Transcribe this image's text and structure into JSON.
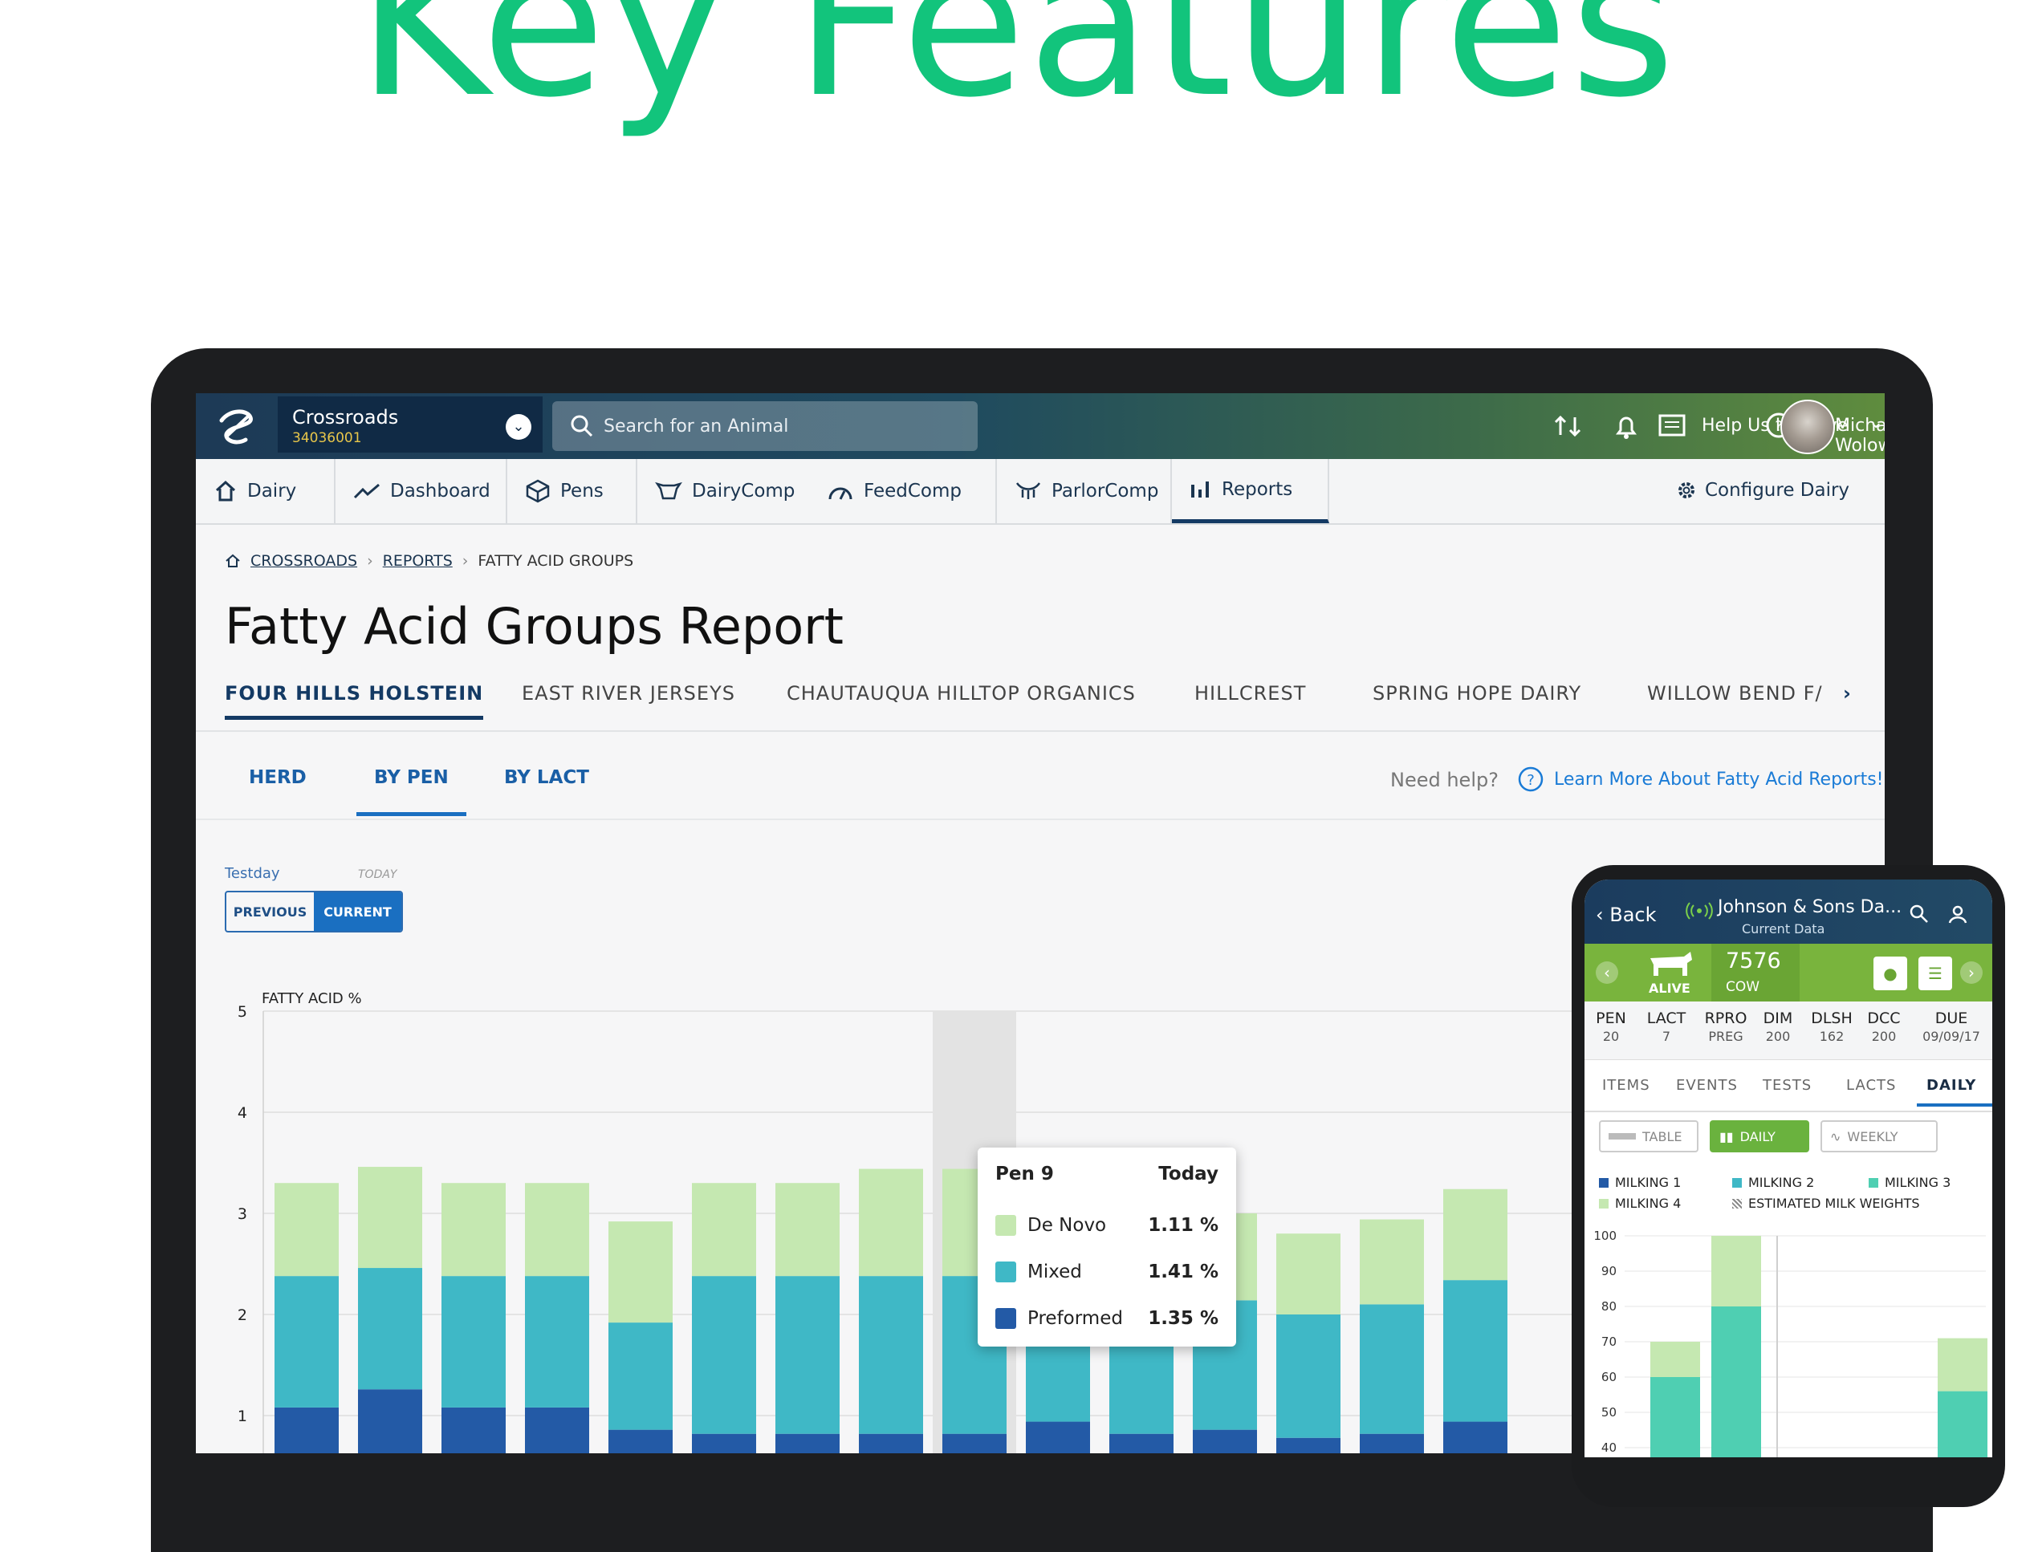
{
  "headline": "Key Features",
  "topbar": {
    "dairy_name": "Crossroads",
    "dairy_id": "34036001",
    "search_placeholder": "Search for an Animal",
    "help_improve": "Help Us Improve",
    "user_name": "Michael Wolowitz"
  },
  "nav": {
    "items": [
      {
        "label": "Dairy",
        "icon": "home-icon"
      },
      {
        "label": "Dashboard",
        "icon": "trend-icon"
      },
      {
        "label": "Pens",
        "icon": "pens-icon"
      },
      {
        "label": "DairyComp",
        "icon": "cow-head-icon"
      },
      {
        "label": "FeedComp",
        "icon": "gauge-icon"
      },
      {
        "label": "ParlorComp",
        "icon": "udder-icon"
      },
      {
        "label": "Reports",
        "icon": "bar-chart-icon"
      }
    ],
    "configure": "Configure Dairy"
  },
  "breadcrumb": [
    "CROSSROADS",
    "REPORTS",
    "FATTY ACID GROUPS"
  ],
  "page_title": "Fatty Acid Groups Report",
  "herd_tabs": [
    "FOUR HILLS HOLSTEIN",
    "EAST RIVER JERSEYS",
    "CHAUTAUQUA HILLTOP ORGANICS",
    "HILLCREST",
    "SPRING HOPE DAIRY",
    "WILLOW BEND F/"
  ],
  "sub_tabs": [
    "HERD",
    "BY PEN",
    "BY LACT"
  ],
  "help": {
    "need_help": "Need help?",
    "learn_more": "Learn More About Fatty Acid Reports!"
  },
  "testday": {
    "label": "Testday",
    "today": "TODAY",
    "previous": "PREVIOUS",
    "current": "CURRENT"
  },
  "colors": {
    "headline": "#12c47c",
    "de_novo": "#c5e8b1",
    "mixed": "#3fb8c6",
    "preformed": "#235aa6",
    "phone_accent": "#79b43d"
  },
  "chart_data": [
    {
      "type": "bar",
      "stacked": true,
      "ylabel": "FATTY ACID %",
      "ylim": [
        0,
        5
      ],
      "yticks": [
        1,
        2,
        3,
        4,
        5
      ],
      "highlight_index": 8,
      "series": [
        {
          "name": "Preformed",
          "color": "#235aa6",
          "values": [
            1.08,
            1.26,
            1.08,
            1.08,
            0.86,
            0.82,
            0.82,
            0.82,
            0.82,
            0.94,
            0.82,
            0.86,
            0.78,
            0.82,
            0.94
          ]
        },
        {
          "name": "Mixed",
          "color": "#3fb8c6",
          "values": [
            1.3,
            1.2,
            1.3,
            1.3,
            1.06,
            1.56,
            1.56,
            1.56,
            1.56,
            1.5,
            1.56,
            1.28,
            1.22,
            1.28,
            1.4
          ]
        },
        {
          "name": "De Novo",
          "color": "#c5e8b1",
          "values": [
            0.92,
            1.0,
            0.92,
            0.92,
            1.0,
            0.92,
            0.92,
            1.06,
            1.06,
            0.88,
            0.68,
            0.86,
            0.8,
            0.84,
            0.9
          ]
        }
      ],
      "tooltip": {
        "title": "Pen 9",
        "period": "Today",
        "rows": [
          {
            "label": "De Novo",
            "value": "1.11 %",
            "color": "#c5e8b1"
          },
          {
            "label": "Mixed",
            "value": "1.41 %",
            "color": "#3fb8c6"
          },
          {
            "label": "Preformed",
            "value": "1.35 %",
            "color": "#235aa6"
          }
        ]
      }
    },
    {
      "type": "bar",
      "stacked": true,
      "ylim": [
        40,
        100
      ],
      "yticks": [
        40,
        50,
        60,
        70,
        80,
        90,
        100
      ],
      "series": [
        {
          "name": "MILKING 1",
          "color": "#235aa6",
          "values": []
        },
        {
          "name": "MILKING 2",
          "color": "#3fb8c6",
          "values": []
        },
        {
          "name": "MILKING 3",
          "color": "#4fcfb2",
          "values": [
            60,
            80,
            56
          ]
        },
        {
          "name": "MILKING 4",
          "color": "#c5e8b1",
          "values": [
            10,
            20,
            15
          ]
        }
      ]
    }
  ],
  "phone": {
    "back": "Back",
    "dairy_name": "Johnson & Sons Da...",
    "current_data": "Current Data",
    "status": "ALIVE",
    "cow_id": "7576",
    "cow_type": "COW",
    "stats": [
      {
        "k": "PEN",
        "v": "20"
      },
      {
        "k": "LACT",
        "v": "7"
      },
      {
        "k": "RPRO",
        "v": "PREG"
      },
      {
        "k": "DIM",
        "v": "200"
      },
      {
        "k": "DLSH",
        "v": "162"
      },
      {
        "k": "DCC",
        "v": "200"
      },
      {
        "k": "DUE",
        "v": "09/09/17"
      }
    ],
    "tabs": [
      "ITEMS",
      "EVENTS",
      "TESTS",
      "LACTS",
      "DAILY"
    ],
    "view_buttons": [
      "TABLE",
      "DAILY",
      "WEEKLY"
    ],
    "legend": [
      "MILKING 1",
      "MILKING 2",
      "MILKING 3",
      "MILKING 4",
      "ESTIMATED MILK WEIGHTS"
    ]
  }
}
